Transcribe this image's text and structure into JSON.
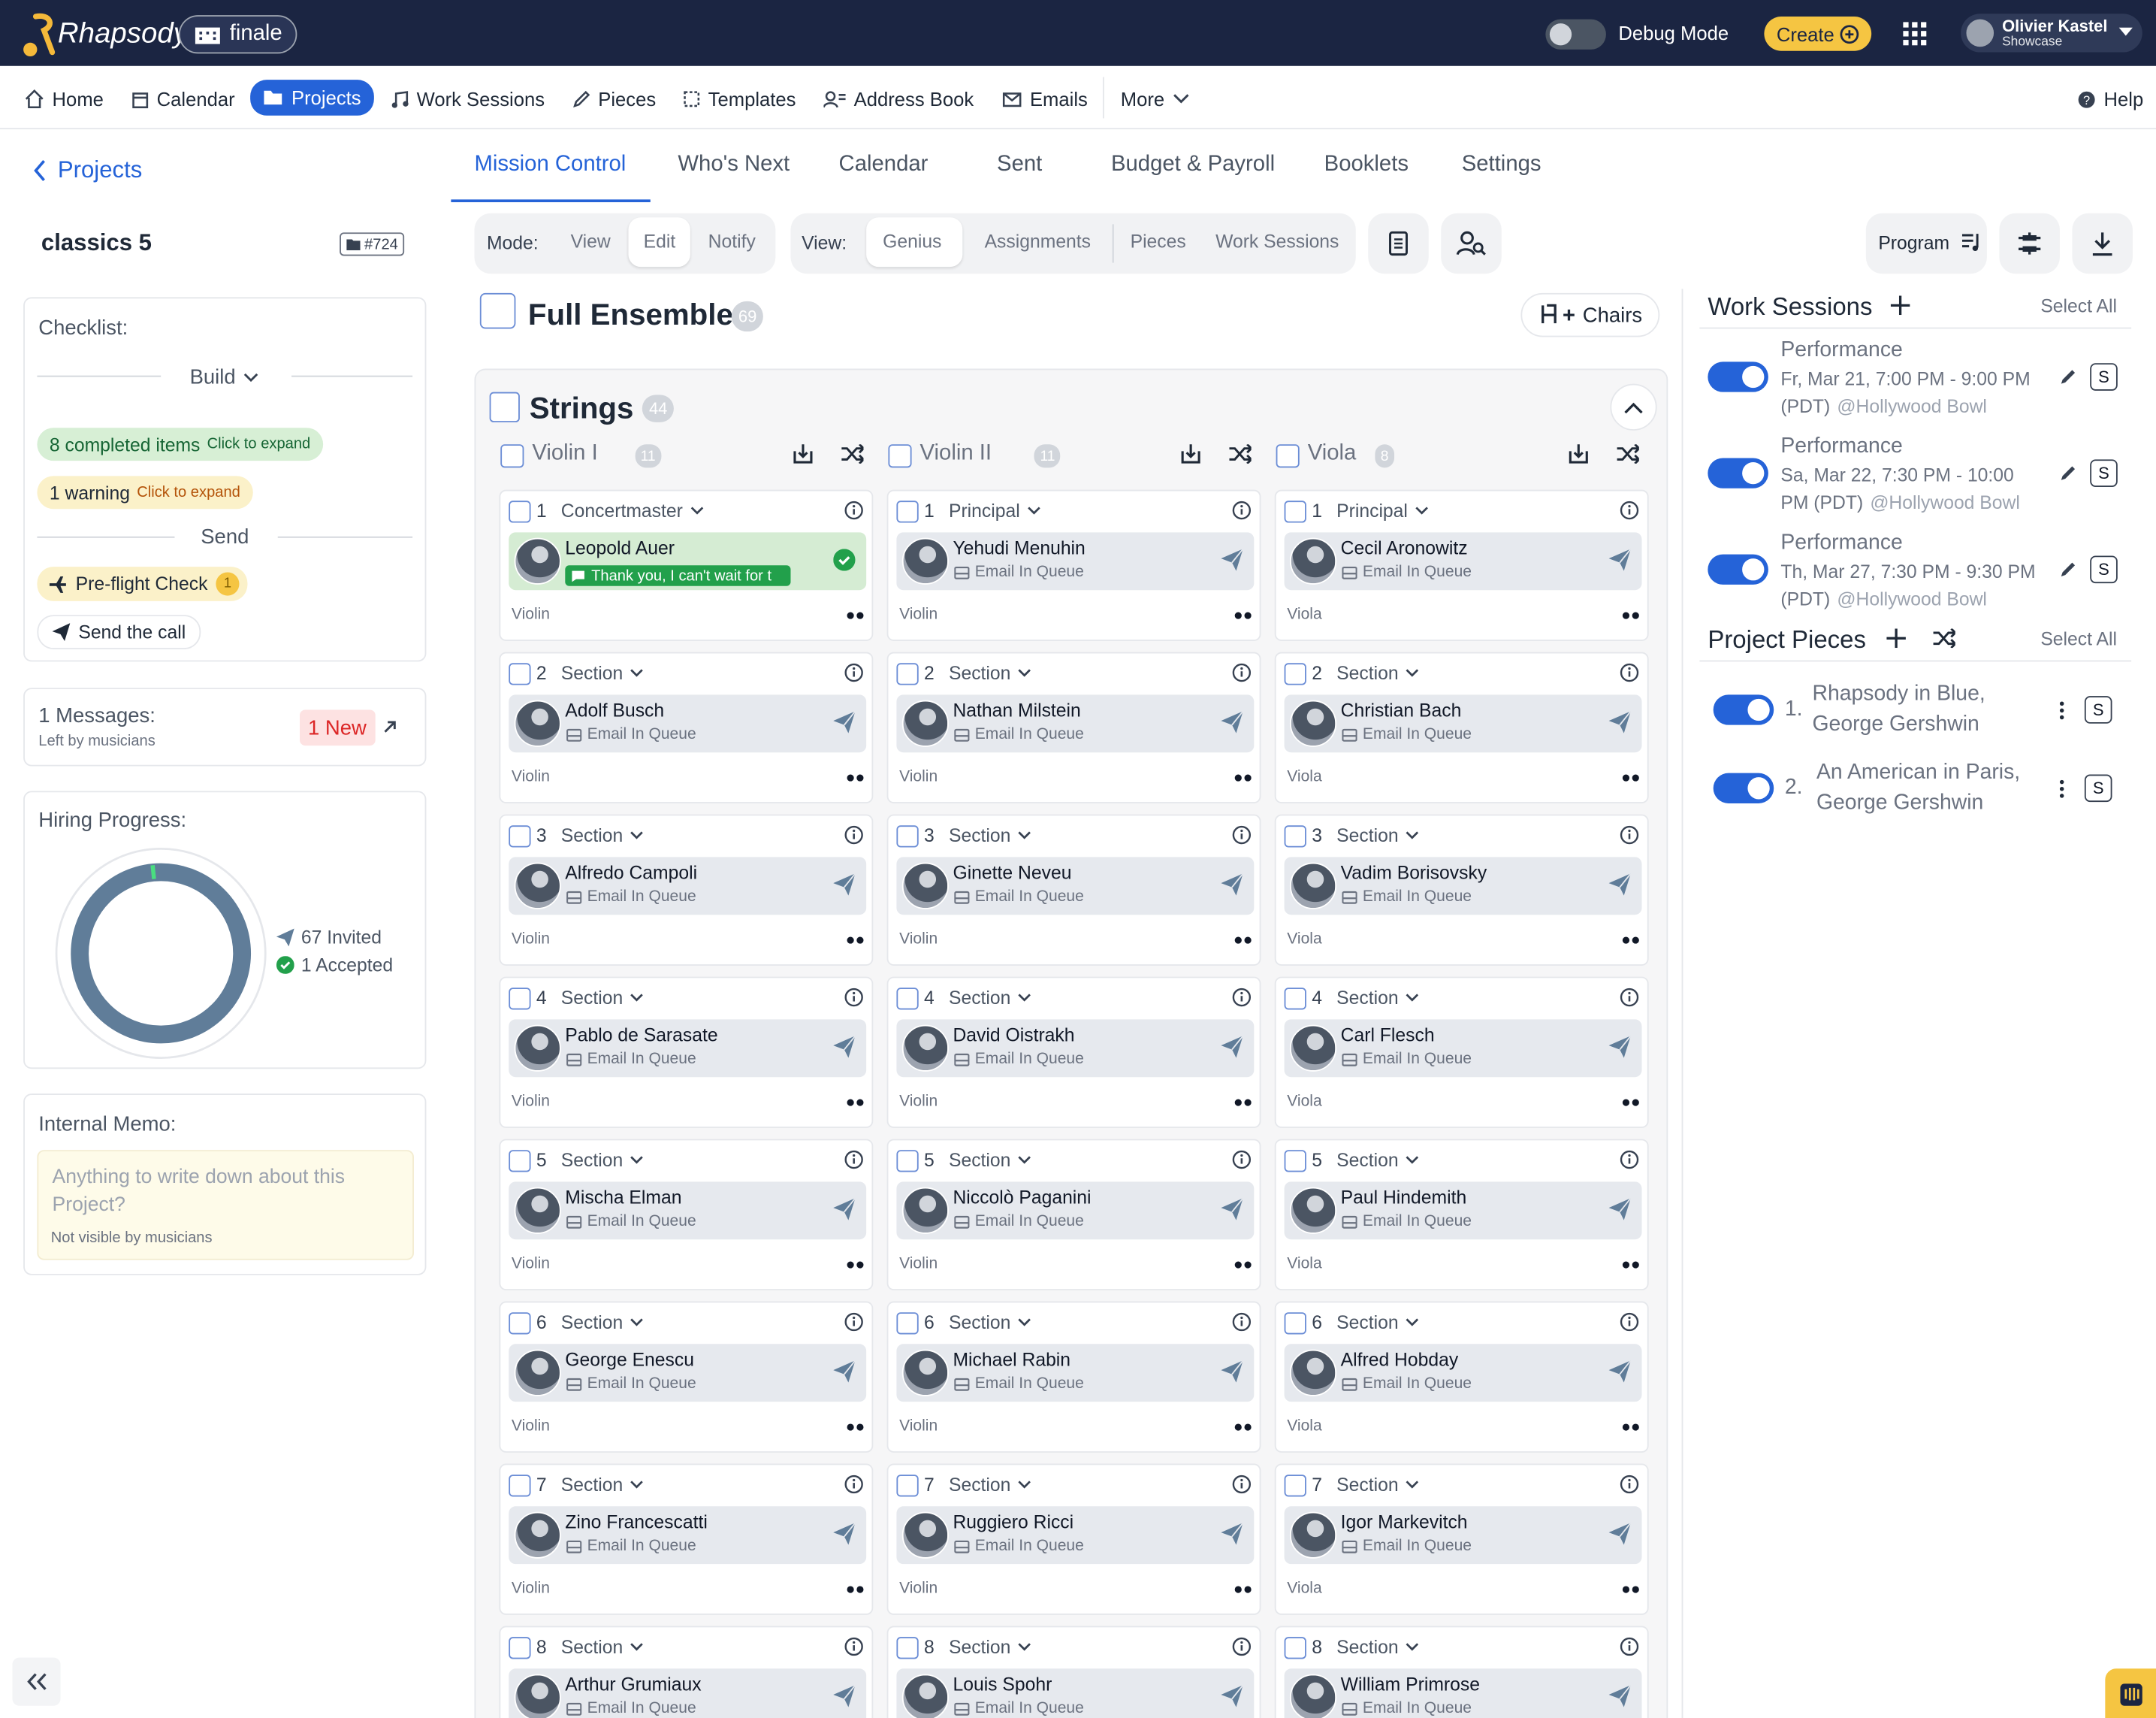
{
  "brand": {
    "logo": "Rhapsody",
    "workspace": "finale"
  },
  "topbar": {
    "debug_label": "Debug Mode",
    "create_label": "Create",
    "user_name": "Olivier Kastel",
    "user_sub": "Showcase"
  },
  "nav": [
    {
      "label": "Home",
      "icon": "home-icon"
    },
    {
      "label": "Calendar",
      "icon": "calendar-icon"
    },
    {
      "label": "Projects",
      "icon": "folder-icon",
      "active": true
    },
    {
      "label": "Work Sessions",
      "icon": "music-note-icon"
    },
    {
      "label": "Pieces",
      "icon": "pen-icon"
    },
    {
      "label": "Templates",
      "icon": "templates-icon"
    },
    {
      "label": "Address Book",
      "icon": "address-book-icon"
    },
    {
      "label": "Emails",
      "icon": "mail-icon"
    },
    {
      "label": "More",
      "icon": "chevron-down-icon"
    }
  ],
  "help": "Help",
  "sidebar": {
    "back": "Projects",
    "project_name": "classics 5",
    "project_id": "#724",
    "checklist_title": "Checklist:",
    "build": "Build",
    "completed": "8 completed items",
    "completed_hint": "Click to expand",
    "warning": "1 warning",
    "warning_hint": "Click to expand",
    "send": "Send",
    "preflight": "Pre-flight Check",
    "preflight_count": "1",
    "send_call": "Send the call",
    "messages_title": "1 Messages:",
    "messages_sub": "Left by musicians",
    "messages_new": "1 New",
    "hiring_title": "Hiring Progress:",
    "invited": "67 Invited",
    "accepted": "1 Accepted",
    "memo_title": "Internal Memo:",
    "memo_placeholder": "Anything to write down about this Project?",
    "memo_note": "Not visible by musicians"
  },
  "tabs": [
    "Mission Control",
    "Who's Next",
    "Calendar",
    "Sent",
    "Budget & Payroll",
    "Booklets",
    "Settings"
  ],
  "mode": {
    "label": "Mode:",
    "options": [
      "View",
      "Edit",
      "Notify"
    ],
    "selected": "Edit"
  },
  "view": {
    "label": "View:",
    "options": [
      "Genius",
      "Assignments",
      "Pieces",
      "Work Sessions"
    ],
    "selected": "Genius"
  },
  "toolbar": {
    "program": "Program",
    "chairs": "Chairs"
  },
  "ensemble": {
    "title": "Full Ensemble",
    "count": "69",
    "family": "Strings",
    "family_count": "44"
  },
  "sections": [
    {
      "name": "Violin I",
      "count": "11",
      "instrument": "Violin",
      "chairs": [
        {
          "num": "1",
          "role": "Concertmaster",
          "name": "Leopold Auer",
          "status": "Thank you, I can't wait for t",
          "accepted": true
        },
        {
          "num": "2",
          "role": "Section",
          "name": "Adolf Busch",
          "status": "Email In Queue"
        },
        {
          "num": "3",
          "role": "Section",
          "name": "Alfredo Campoli",
          "status": "Email In Queue"
        },
        {
          "num": "4",
          "role": "Section",
          "name": "Pablo de Sarasate",
          "status": "Email In Queue"
        },
        {
          "num": "5",
          "role": "Section",
          "name": "Mischa Elman",
          "status": "Email In Queue"
        },
        {
          "num": "6",
          "role": "Section",
          "name": "George Enescu",
          "status": "Email In Queue"
        },
        {
          "num": "7",
          "role": "Section",
          "name": "Zino Francescatti",
          "status": "Email In Queue"
        },
        {
          "num": "8",
          "role": "Section",
          "name": "Arthur Grumiaux",
          "status": "Email In Queue"
        }
      ]
    },
    {
      "name": "Violin II",
      "count": "11",
      "instrument": "Violin",
      "chairs": [
        {
          "num": "1",
          "role": "Principal",
          "name": "Yehudi Menuhin",
          "status": "Email In Queue"
        },
        {
          "num": "2",
          "role": "Section",
          "name": "Nathan Milstein",
          "status": "Email In Queue"
        },
        {
          "num": "3",
          "role": "Section",
          "name": "Ginette Neveu",
          "status": "Email In Queue"
        },
        {
          "num": "4",
          "role": "Section",
          "name": "David Oistrakh",
          "status": "Email In Queue"
        },
        {
          "num": "5",
          "role": "Section",
          "name": "Niccolò Paganini",
          "status": "Email In Queue"
        },
        {
          "num": "6",
          "role": "Section",
          "name": "Michael Rabin",
          "status": "Email In Queue"
        },
        {
          "num": "7",
          "role": "Section",
          "name": "Ruggiero Ricci",
          "status": "Email In Queue"
        },
        {
          "num": "8",
          "role": "Section",
          "name": "Louis Spohr",
          "status": "Email In Queue"
        }
      ]
    },
    {
      "name": "Viola",
      "count": "8",
      "instrument": "Viola",
      "chairs": [
        {
          "num": "1",
          "role": "Principal",
          "name": "Cecil Aronowitz",
          "status": "Email In Queue"
        },
        {
          "num": "2",
          "role": "Section",
          "name": "Christian Bach",
          "status": "Email In Queue"
        },
        {
          "num": "3",
          "role": "Section",
          "name": "Vadim Borisovsky",
          "status": "Email In Queue"
        },
        {
          "num": "4",
          "role": "Section",
          "name": "Carl Flesch",
          "status": "Email In Queue"
        },
        {
          "num": "5",
          "role": "Section",
          "name": "Paul Hindemith",
          "status": "Email In Queue"
        },
        {
          "num": "6",
          "role": "Section",
          "name": "Alfred Hobday",
          "status": "Email In Queue"
        },
        {
          "num": "7",
          "role": "Section",
          "name": "Igor Markevitch",
          "status": "Email In Queue"
        },
        {
          "num": "8",
          "role": "Section",
          "name": "William Primrose",
          "status": "Email In Queue"
        }
      ]
    }
  ],
  "work_sessions": {
    "title": "Work Sessions",
    "select_all": "Select All",
    "items": [
      {
        "title": "Performance",
        "line1": "Fr, Mar 21, 7:00 PM - 9:00 PM",
        "line2": "(PDT)",
        "venue": "@Hollywood Bowl"
      },
      {
        "title": "Performance",
        "line1": "Sa, Mar 22, 7:30 PM - 10:00",
        "line2": "PM (PDT)",
        "venue": "@Hollywood Bowl"
      },
      {
        "title": "Performance",
        "line1": "Th, Mar 27, 7:30 PM - 9:30 PM",
        "line2": "(PDT)",
        "venue": "@Hollywood Bowl"
      }
    ]
  },
  "project_pieces": {
    "title": "Project Pieces",
    "select_all": "Select All",
    "items": [
      {
        "num": "1.",
        "line1": "Rhapsody in Blue,",
        "line2": "George Gershwin"
      },
      {
        "num": "2.",
        "line1": "An American in Paris,",
        "line2": "George Gershwin"
      }
    ]
  },
  "s_label": "S",
  "colors": {
    "navy": "#1b2542",
    "accent": "#2563d8",
    "create": "#f5c542"
  }
}
